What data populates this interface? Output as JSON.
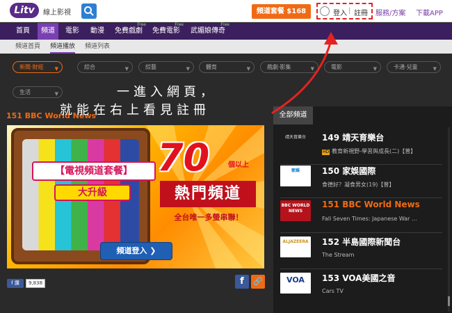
{
  "header": {
    "logo_text": "Litv",
    "logo_sub": "線上影視",
    "package_button": "頻道套餐 $168",
    "login": "登入",
    "separator": "|",
    "register": "註冊",
    "service_link": "服務/方案",
    "download_link": "下載APP"
  },
  "main_nav": [
    {
      "label": "首頁",
      "free": ""
    },
    {
      "label": "頻道",
      "free": ""
    },
    {
      "label": "電影",
      "free": ""
    },
    {
      "label": "動漫",
      "free": ""
    },
    {
      "label": "免費戲劇",
      "free": "Free"
    },
    {
      "label": "免費電影",
      "free": "Free"
    },
    {
      "label": "武媚娘傳奇",
      "free": "Free"
    }
  ],
  "sub_nav": [
    "頻道首頁",
    "頻道播放",
    "頻道列表"
  ],
  "filters": [
    "新聞‧財經",
    "綜合",
    "綜藝",
    "體育",
    "戲劇‧影集",
    "電影",
    "卡通‧兒童",
    "生活"
  ],
  "annotation": {
    "line1": "一進入網頁，",
    "line2": "就能在右上看見註冊"
  },
  "player": {
    "title": "151  BBC World News",
    "promo_line1": "【電視頻道套餐】",
    "promo_line2": "大升級",
    "promo_number": "70",
    "promo_more": "個以上",
    "promo_hot": "熱門頻道",
    "promo_only": "全台唯一多螢串聯！",
    "promo_button": "頻道登入 ❯"
  },
  "social": {
    "fb_like": "f 讚",
    "fb_count": "9,838",
    "share_fb": "f",
    "share_link": "🔗"
  },
  "panel": {
    "tab": "全部頻道",
    "channels": [
      {
        "number_name": "149  靖天育樂台",
        "hd": "HD",
        "program": "教育新視野-學習與成長(二)【普】",
        "logo": "靖天育樂台"
      },
      {
        "number_name": "150  家娛國際",
        "hd": "",
        "program": "食德好？凝食男女(19)【普】",
        "logo": "家娛"
      },
      {
        "number_name": "151  BBC World News",
        "hd": "",
        "program": "Fall Seven Times: Japanese War ...",
        "logo": "BBC WORLD NEWS"
      },
      {
        "number_name": "152  半島國際新聞台",
        "hd": "",
        "program": "The Stream",
        "logo": "ALJAZEERA"
      },
      {
        "number_name": "153  VOA美國之音",
        "hd": "",
        "program": "Cars TV",
        "logo": "VOA"
      }
    ]
  },
  "colors": {
    "accent_orange": "#f06a14",
    "brand_purple": "#3c1f5e",
    "annotation_red": "#e52222"
  }
}
